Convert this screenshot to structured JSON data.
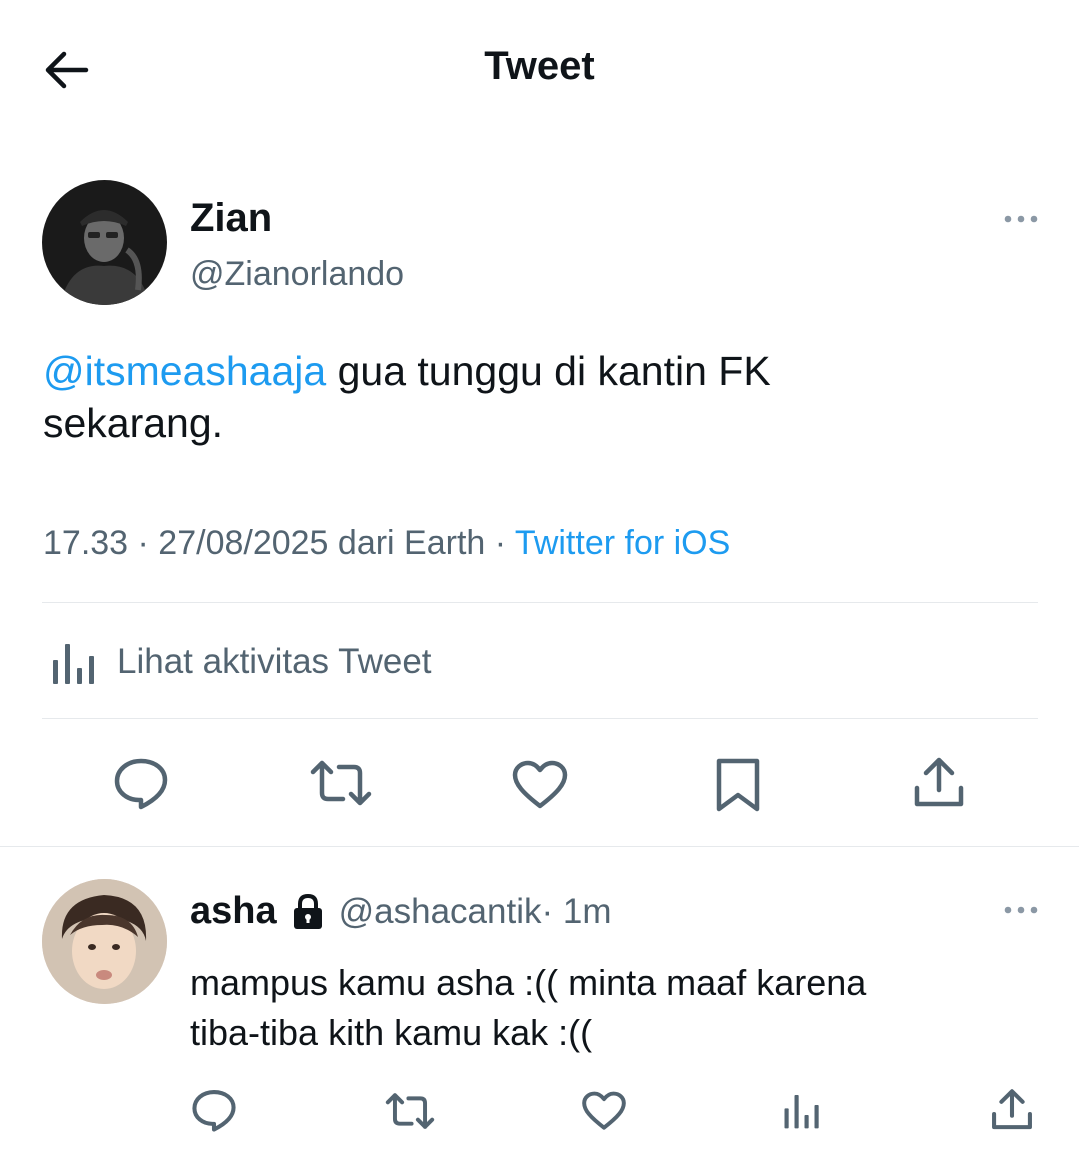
{
  "header": {
    "title": "Tweet"
  },
  "tweet": {
    "author_name": "Zian",
    "author_handle": "@Zianorlando",
    "mention": "@itsmeashaaja",
    "text_line1": " gua tunggu di kantin FK",
    "text_line2": "sekarang.",
    "time_date": "17.33 · 27/08/2025 dari Earth · ",
    "source": "Twitter for iOS",
    "activity_label": "Lihat aktivitas Tweet"
  },
  "reply": {
    "author_name": "asha",
    "author_handle": "@ashacantik",
    "time": " · 1m",
    "text_line1": "mampus kamu asha :(( minta maaf karena",
    "text_line2": "tiba-tiba kith kamu kak :(("
  },
  "colors": {
    "accent": "#1d9bf0",
    "muted": "#536471",
    "text": "#0f1419"
  }
}
